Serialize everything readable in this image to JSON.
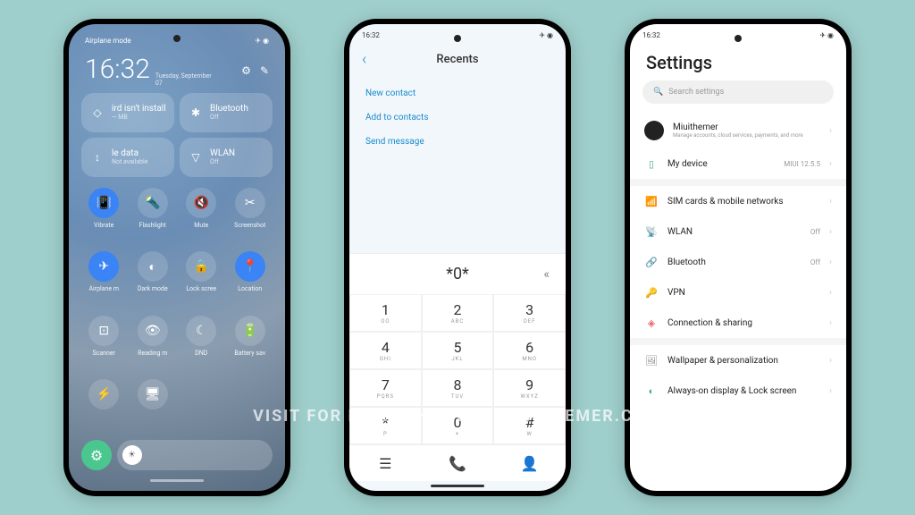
{
  "watermark": "VISIT FOR MORE THEMES - MIUITHEMER.COM",
  "cc": {
    "status_left": "Airplane mode",
    "clock": "16:32",
    "date_day": "Tuesday, September",
    "date_num": "07",
    "tiles": [
      {
        "label": "ird isn't install",
        "sub": "— MB",
        "icon": "◇"
      },
      {
        "label": "Bluetooth",
        "sub": "Off",
        "icon": "✱"
      },
      {
        "label": "le data",
        "sub": "Not available",
        "icon": "↕"
      },
      {
        "label": "WLAN",
        "sub": "Off",
        "icon": "▽"
      }
    ],
    "toggles": [
      {
        "label": "Vibrate",
        "icon": "📳",
        "active": true
      },
      {
        "label": "Flashlight",
        "icon": "🔦",
        "active": false
      },
      {
        "label": "Mute",
        "icon": "🔇",
        "active": false
      },
      {
        "label": "Screenshot",
        "icon": "✂",
        "active": false
      },
      {
        "label": "Airplane m",
        "icon": "✈",
        "active": true
      },
      {
        "label": "Dark mode",
        "icon": "◐",
        "active": false
      },
      {
        "label": "Lock scree",
        "icon": "🔒",
        "active": false
      },
      {
        "label": "Location",
        "icon": "📍",
        "active": true
      },
      {
        "label": "Scanner",
        "icon": "⊡",
        "active": false
      },
      {
        "label": "Reading m",
        "icon": "👁",
        "active": false
      },
      {
        "label": "DND",
        "icon": "☾",
        "active": false
      },
      {
        "label": "Battery sav",
        "icon": "🔋",
        "active": false
      },
      {
        "label": "",
        "icon": "⚡",
        "active": false
      },
      {
        "label": "",
        "icon": "🖥",
        "active": false
      }
    ]
  },
  "dialer": {
    "time": "16:32",
    "title": "Recents",
    "links": [
      "New contact",
      "Add to contacts",
      "Send message"
    ],
    "input": "*0*",
    "keys": [
      {
        "n": "1",
        "s": "OO"
      },
      {
        "n": "2",
        "s": "ABC"
      },
      {
        "n": "3",
        "s": "DEF"
      },
      {
        "n": "4",
        "s": "GHI"
      },
      {
        "n": "5",
        "s": "JKL"
      },
      {
        "n": "6",
        "s": "MNO"
      },
      {
        "n": "7",
        "s": "PQRS"
      },
      {
        "n": "8",
        "s": "TUV"
      },
      {
        "n": "9",
        "s": "WXYZ"
      },
      {
        "n": "*",
        "s": "P"
      },
      {
        "n": "0",
        "s": "+"
      },
      {
        "n": "#",
        "s": "W"
      }
    ]
  },
  "settings": {
    "time": "16:32",
    "title": "Settings",
    "search": "Search settings",
    "account": {
      "name": "Miuithemer",
      "sub": "Manage accounts, cloud services, payments, and more"
    },
    "device": {
      "label": "My device",
      "val": "MIUI 12.5.5"
    },
    "items": [
      {
        "icon": "📶",
        "color": "#f5a623",
        "label": "SIM cards & mobile networks",
        "val": ""
      },
      {
        "icon": "📡",
        "color": "#e66",
        "label": "WLAN",
        "val": "Off"
      },
      {
        "icon": "🔗",
        "color": "#4ac",
        "label": "Bluetooth",
        "val": "Off"
      },
      {
        "icon": "🔑",
        "color": "#f5c242",
        "label": "VPN",
        "val": ""
      },
      {
        "icon": "◈",
        "color": "#e66",
        "label": "Connection & sharing",
        "val": ""
      }
    ],
    "items2": [
      {
        "icon": "🖼",
        "color": "#888",
        "label": "Wallpaper & personalization",
        "val": ""
      },
      {
        "icon": "◐",
        "color": "#4a9",
        "label": "Always-on display & Lock screen",
        "val": ""
      }
    ]
  }
}
